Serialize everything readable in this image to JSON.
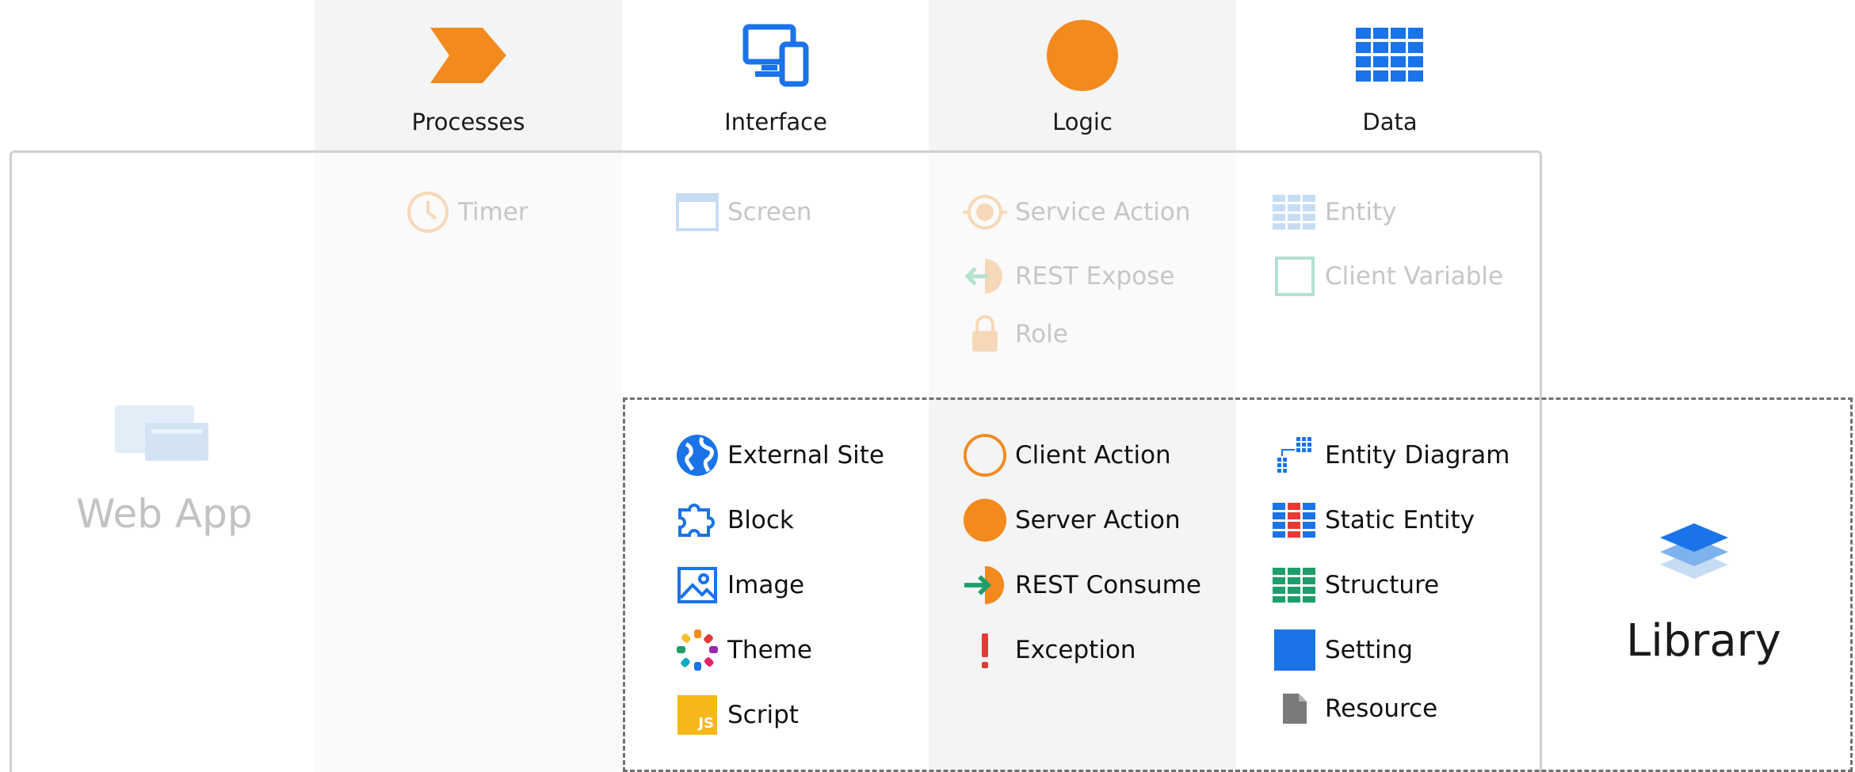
{
  "columns": {
    "processes": "Processes",
    "interface": "Interface",
    "logic": "Logic",
    "data": "Data"
  },
  "webapp": {
    "label": "Web App",
    "processes": [
      "Timer"
    ],
    "interface": [
      "Screen"
    ],
    "logic": [
      "Service Action",
      "REST Expose",
      "Role"
    ],
    "data": [
      "Entity",
      "Client Variable"
    ]
  },
  "library": {
    "label": "Library",
    "interface": [
      "External Site",
      "Block",
      "Image",
      "Theme",
      "Script"
    ],
    "logic": [
      "Client Action",
      "Server Action",
      "REST Consume",
      "Exception"
    ],
    "data": [
      "Entity Diagram",
      "Static Entity",
      "Structure",
      "Setting",
      "Resource"
    ]
  },
  "icons": {
    "processes": "chevron-process-icon",
    "interface": "devices-icon",
    "logic": "orange-circle-icon",
    "data": "grid-table-icon",
    "script_badge": "JS"
  },
  "colors": {
    "orange": "#f28a1e",
    "blue": "#1a73e8",
    "green": "#1e9e6a",
    "red": "#e53935",
    "faded_text": "#c6c6c6"
  }
}
